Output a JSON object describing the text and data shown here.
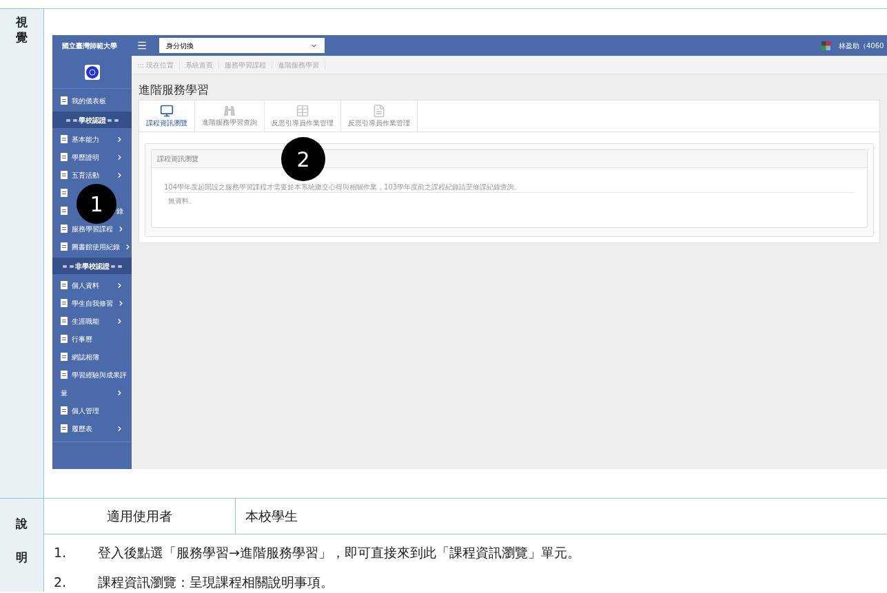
{
  "visual_label": "視覺",
  "screenshot": {
    "header": {
      "brand": "國立臺灣師範大學",
      "identity_select": "身分切換",
      "user": "林盈助（4060"
    },
    "sidebar": {
      "items": [
        {
          "kind": "link",
          "label": "我的儀表板",
          "chevron": false
        },
        {
          "kind": "section",
          "label": "＝＝學校認證＝＝"
        },
        {
          "kind": "link",
          "label": "基本能力",
          "chevron": true
        },
        {
          "kind": "link",
          "label": "學歷證明",
          "chevron": true
        },
        {
          "kind": "link",
          "label": "五育活動",
          "chevron": true
        },
        {
          "kind": "link"
        },
        {
          "kind": "link",
          "label_end": "錄"
        },
        {
          "kind": "link",
          "label": "服務學習課程",
          "chevron": true
        },
        {
          "kind": "link",
          "label": "圖書館使用紀錄",
          "chevron": true
        },
        {
          "kind": "section",
          "label": "＝＝非學校認證＝＝"
        },
        {
          "kind": "link",
          "label": "個人資料",
          "chevron": true
        },
        {
          "kind": "link",
          "label": "學生自我修習",
          "chevron": true
        },
        {
          "kind": "link",
          "label": "生涯職能",
          "chevron": true
        },
        {
          "kind": "link",
          "label": "行事曆",
          "chevron": false
        },
        {
          "kind": "link",
          "label": "網誌相簿",
          "chevron": false
        },
        {
          "kind": "link",
          "label": "學習經驗與成果評",
          "chevron": false
        },
        {
          "kind": "continuation",
          "label": "量",
          "chevron": true
        },
        {
          "kind": "link",
          "label": "個人管理",
          "chevron": false
        },
        {
          "kind": "link",
          "label": "履歷表",
          "chevron": true
        }
      ]
    },
    "breadcrumb": [
      "::: 現在位置",
      "系統首頁",
      "服務學習課程",
      "進階服務學習"
    ],
    "page_title": "進階服務學習",
    "tabs": [
      {
        "label": "課程資訊瀏覽",
        "kind": "monitor",
        "selected": true
      },
      {
        "label": "進階服務學習查詢",
        "kind": "binoculars",
        "selected": false
      },
      {
        "label": "反思引導員作業管理",
        "kind": "table",
        "selected": false
      },
      {
        "label": "反思引導員作業管理",
        "kind": "document",
        "selected": false
      }
    ],
    "panel": {
      "title": "課程資訊瀏覽",
      "notice": "104學年度起開設之服務學習課程才需要於本系統繳交心得與相關作業，103學年度前之課程紀錄請至修課紀錄查詢。",
      "empty": "無資料。"
    },
    "callouts": [
      "1",
      "2"
    ]
  },
  "description_label": "說明",
  "applicable": {
    "label": "適用使用者",
    "value": "本校學生"
  },
  "steps": [
    {
      "number": "1.",
      "text": "登入後點選「服務學習→進階服務學習」，即可直接來到此「課程資訊瀏覽」單元。"
    },
    {
      "number": "2.",
      "text": "課程資訊瀏覽：呈現課程相關說明事項。"
    }
  ]
}
